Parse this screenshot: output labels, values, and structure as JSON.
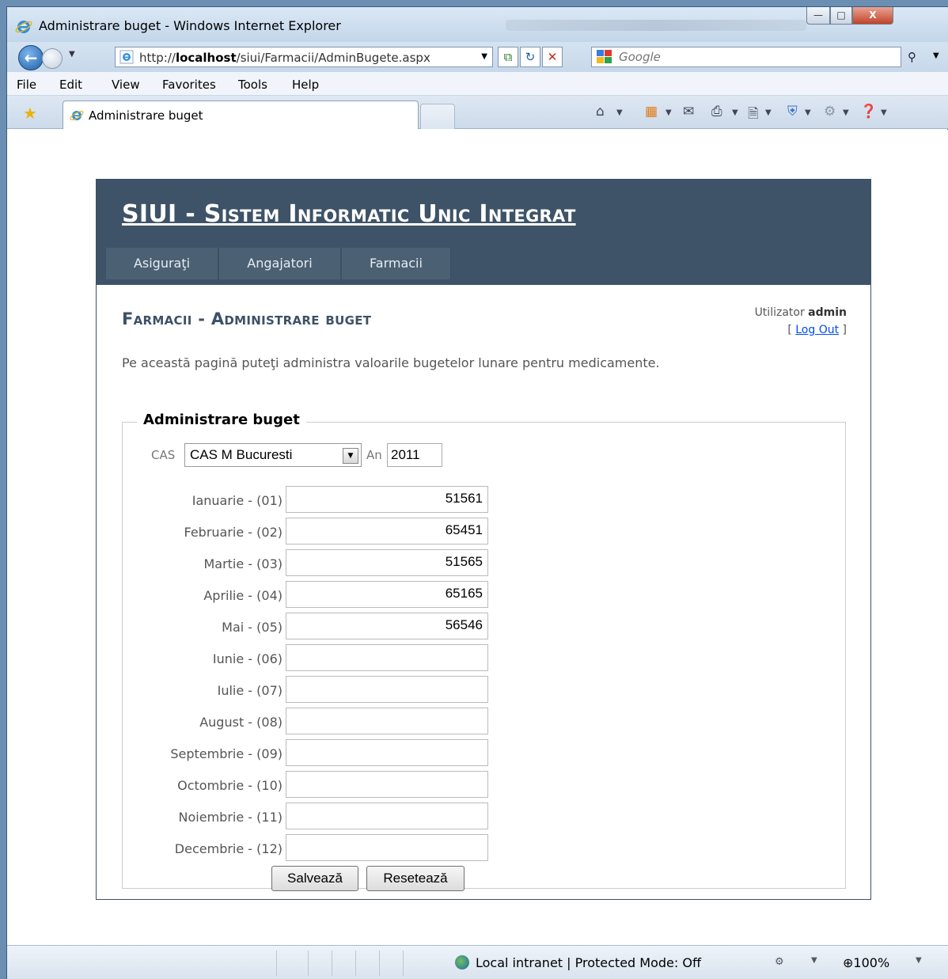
{
  "window": {
    "title": "Administrare buget - Windows Internet Explorer",
    "buttons": {
      "minimize": "—",
      "maximize": "□",
      "close": "X"
    }
  },
  "address_bar": {
    "url_prefix": "http://",
    "url_host": "localhost",
    "url_path": "/siui/Farmacii/AdminBugete.aspx",
    "search_placeholder": "Google"
  },
  "menu": [
    "File",
    "Edit",
    "View",
    "Favorites",
    "Tools",
    "Help"
  ],
  "tab": {
    "title": "Administrare buget"
  },
  "site": {
    "title": "SIUI - Sistem Informatic Unic Integrat",
    "nav": [
      "Asiguraţi",
      "Angajatori",
      "Farmacii"
    ]
  },
  "page": {
    "heading": "Farmacii - Administrare buget",
    "user_label": "Utilizator",
    "user_name": "admin",
    "logout_open": "[",
    "logout": "Log Out",
    "logout_close": "]",
    "intro": "Pe această pagină puteţi administra valoarile bugetelor lunare pentru medicamente."
  },
  "form": {
    "legend": "Administrare buget",
    "cas_label": "CAS",
    "cas_value": "CAS M Bucuresti",
    "year_label": "An",
    "year_value": "2011",
    "months": [
      {
        "label": "Ianuarie - (01)",
        "value": "51561"
      },
      {
        "label": "Februarie - (02)",
        "value": "65451"
      },
      {
        "label": "Martie - (03)",
        "value": "51565"
      },
      {
        "label": "Aprilie - (04)",
        "value": "65165"
      },
      {
        "label": "Mai - (05)",
        "value": "56546"
      },
      {
        "label": "Iunie - (06)",
        "value": ""
      },
      {
        "label": "Iulie - (07)",
        "value": ""
      },
      {
        "label": "August - (08)",
        "value": ""
      },
      {
        "label": "Septembrie - (09)",
        "value": ""
      },
      {
        "label": "Octombrie - (10)",
        "value": ""
      },
      {
        "label": "Noiembrie - (11)",
        "value": ""
      },
      {
        "label": "Decembrie - (12)",
        "value": ""
      }
    ],
    "save_label": "Salvează",
    "reset_label": "Resetează"
  },
  "status_bar": {
    "zone": "Local intranet | Protected Mode: Off",
    "zoom": "100%"
  },
  "colors": {
    "header_bg": "#3e5367",
    "nav_bg": "#4c6073",
    "heading": "#3d5166",
    "link": "#034af3"
  },
  "icons": [
    "ie-logo-icon",
    "back-icon",
    "forward-icon",
    "refresh-icon",
    "stop-icon",
    "search-icon",
    "favorites-star-icon",
    "home-icon",
    "feeds-icon",
    "mail-icon",
    "print-icon",
    "page-icon",
    "safety-icon",
    "tools-icon",
    "help-icon",
    "globe-icon",
    "zoom-icon"
  ]
}
